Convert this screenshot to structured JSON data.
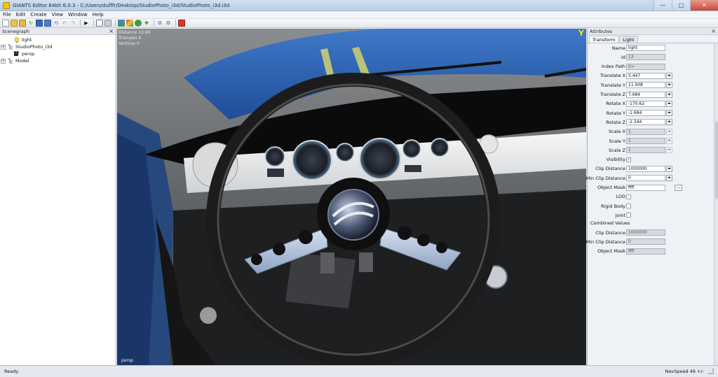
{
  "window": {
    "title": "GIANTS Editor 64bit 6.0.3 - C:/Users/dufffr/Desktop/StudioPhoto_i3d/StudioPhoto_i3d.i3d",
    "minimize_glyph": "—",
    "maximize_glyph": "□",
    "close_glyph": "✕"
  },
  "menu": [
    "File",
    "Edit",
    "Create",
    "View",
    "Window",
    "Help"
  ],
  "toolbar": {
    "icons": [
      "new-file-icon",
      "open-folder-icon",
      "open-icon",
      "reload-icon",
      "save-icon",
      "save-as-icon",
      "undo-history-icon",
      "undo-icon",
      "redo-icon",
      "play-icon",
      "select-icon",
      "lock-icon",
      "terrain-icon",
      "paint-icon",
      "foliage-icon",
      "move-icon",
      "gear-icon",
      "settings-icon",
      "record-icon"
    ]
  },
  "scenegraph": {
    "title": "Scenegraph",
    "close": "×",
    "nodes": [
      {
        "label": "light",
        "expander": "",
        "icon": "light-bulb-icon"
      },
      {
        "label": "StudioPhoto_i3d",
        "expander": "+",
        "icon": "transform-group-icon"
      },
      {
        "label": "persp",
        "expander": "",
        "icon": "camera-icon"
      },
      {
        "label": "Model",
        "expander": "+",
        "icon": "transform-group-icon"
      }
    ]
  },
  "viewport": {
    "stats": [
      "Distance 13.99",
      "Triangles 0",
      "Vertices 0"
    ],
    "camera": "persp",
    "axis_marker": "Y"
  },
  "attributes": {
    "title": "Attributes",
    "close": "×",
    "tabs": [
      "Transform",
      "Light"
    ],
    "active_tab": "Transform",
    "spin_glyph": "◂▸",
    "dots_glyph": "...",
    "check_glyph": "✓",
    "fields": [
      {
        "label": "Name",
        "value": "light",
        "kind": "text"
      },
      {
        "label": "Id",
        "value": "13",
        "kind": "readonly"
      },
      {
        "label": "Index Path",
        "value": "0>",
        "kind": "readonly"
      },
      {
        "label": "Translate X",
        "value": "5.447",
        "kind": "spin"
      },
      {
        "label": "Translate Y",
        "value": "11.908",
        "kind": "spin"
      },
      {
        "label": "Translate Z",
        "value": "7.684",
        "kind": "spin"
      },
      {
        "label": "Rotate X",
        "value": "-170.62",
        "kind": "spin"
      },
      {
        "label": "Rotate Y",
        "value": "-1.684",
        "kind": "spin"
      },
      {
        "label": "Rotate Z",
        "value": "-2.344",
        "kind": "spin"
      },
      {
        "label": "Scale X",
        "value": "1",
        "kind": "spin-ro"
      },
      {
        "label": "Scale Y",
        "value": "1",
        "kind": "spin-ro"
      },
      {
        "label": "Scale Z",
        "value": "1",
        "kind": "spin-ro"
      },
      {
        "label": "Visibility",
        "checked": true,
        "kind": "check"
      },
      {
        "label": "Clip Distance",
        "value": "1000000",
        "kind": "spin"
      },
      {
        "label": "Min Clip Distance",
        "value": "0",
        "kind": "spin"
      },
      {
        "label": "Object Mask",
        "value": "ffff",
        "kind": "dots"
      },
      {
        "label": "LOD",
        "checked": false,
        "kind": "check"
      },
      {
        "label": "Rigid Body",
        "checked": false,
        "kind": "check"
      },
      {
        "label": "Joint",
        "checked": false,
        "kind": "check"
      }
    ],
    "combined_title": "Combined Values",
    "combined": [
      {
        "label": "Clip Distance",
        "value": "1000000"
      },
      {
        "label": "Min Clip Distance",
        "value": "0"
      },
      {
        "label": "Object Mask",
        "value": "ffff"
      }
    ]
  },
  "status": {
    "left": "Ready",
    "right": "NavSpeed 46 +/-"
  },
  "colors": {
    "car_paint": "#2b5fb0",
    "wheel": "#1c1c1c",
    "axis_marker": "#f7e600"
  }
}
